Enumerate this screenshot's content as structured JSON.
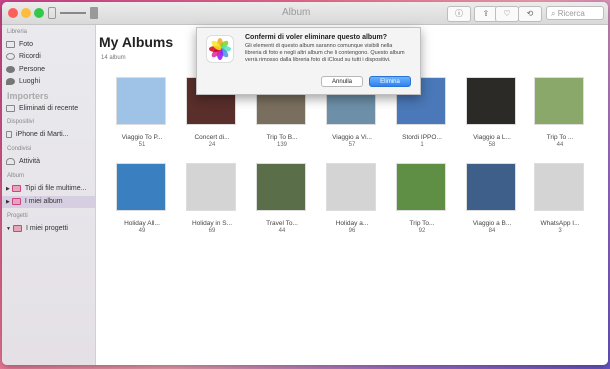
{
  "window": {
    "title": "Album",
    "search_placeholder": "Ricerca"
  },
  "sidebar": {
    "section_libreria": "Libreria",
    "libreria_items": [
      "Foto",
      "Ricordi",
      "Persone",
      "Luoghi"
    ],
    "importers": "Importers",
    "eliminati": "Eliminati di recente",
    "section_dispositivi": "Dispositivi",
    "dispositivi_item": "iPhone di Marti...",
    "section_condivisi": "Condivisi",
    "condivisi_item": "Attività",
    "section_album": "Album",
    "album_items": [
      "Tipi di file multime...",
      "I miei album"
    ],
    "section_progetti": "Progetti",
    "progetti_item": "I miei progetti"
  },
  "main": {
    "title": "My Albums",
    "count_label": "14 album",
    "albums": [
      {
        "name": "Viaggio To P...",
        "count": "51",
        "color": "#9fc3e6"
      },
      {
        "name": "Concert di...",
        "count": "24",
        "color": "#5a2e2a"
      },
      {
        "name": "Trip To B...",
        "count": "139",
        "color": "#7a6f5f"
      },
      {
        "name": "Viaggio a Vi...",
        "count": "57",
        "color": "#6d8fa8"
      },
      {
        "name": "Stordi IPPO...",
        "count": "1",
        "color": "#4a78b8"
      },
      {
        "name": "Viaggio a L...",
        "count": "58",
        "color": "#2c2a26"
      },
      {
        "name": "Trip To ...",
        "count": "44",
        "color": "#8aa86a"
      },
      {
        "name": "Holiday All...",
        "count": "49",
        "color": "#3a7fc0"
      },
      {
        "name": "Holiday in S...",
        "count": "69",
        "color": "#d4d4d4"
      },
      {
        "name": "Travel To...",
        "count": "44",
        "color": "#5b6e4a"
      },
      {
        "name": "Holiday a...",
        "count": "96",
        "color": "#d4d4d4"
      },
      {
        "name": "Trip To...",
        "count": "92",
        "color": "#5e8f45"
      },
      {
        "name": "Viaggio a B...",
        "count": "84",
        "color": "#3d5f8a"
      },
      {
        "name": "WhatsApp I...",
        "count": "3",
        "color": "#d4d4d4"
      }
    ]
  },
  "dialog": {
    "title": "Confermi di voler eliminare questo album?",
    "message": "Gli elementi di questo album saranno comunque visibili nella libreria di foto e negli altri album che li contengono. Questo album verrà rimosso dalla libreria foto di iCloud su tutti i dispositivi.",
    "cancel": "Annulla",
    "confirm": "Elimina"
  }
}
